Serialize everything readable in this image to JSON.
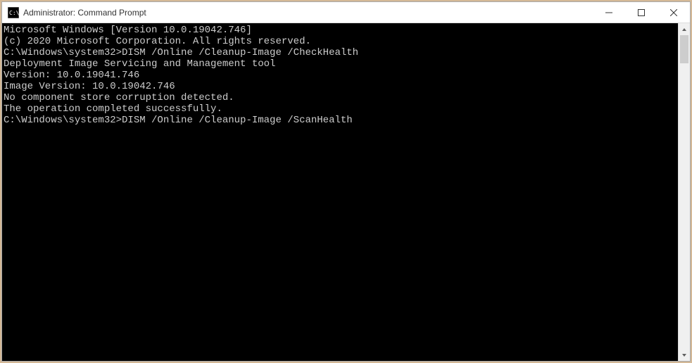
{
  "titlebar": {
    "title": "Administrator: Command Prompt"
  },
  "terminal": {
    "lines": [
      "Microsoft Windows [Version 10.0.19042.746]",
      "(c) 2020 Microsoft Corporation. All rights reserved.",
      "",
      "C:\\Windows\\system32>DISM /Online /Cleanup-Image /CheckHealth",
      "",
      "Deployment Image Servicing and Management tool",
      "Version: 10.0.19041.746",
      "",
      "Image Version: 10.0.19042.746",
      "",
      "No component store corruption detected.",
      "The operation completed successfully.",
      "",
      "C:\\Windows\\system32>DISM /Online /Cleanup-Image /ScanHealth"
    ]
  }
}
